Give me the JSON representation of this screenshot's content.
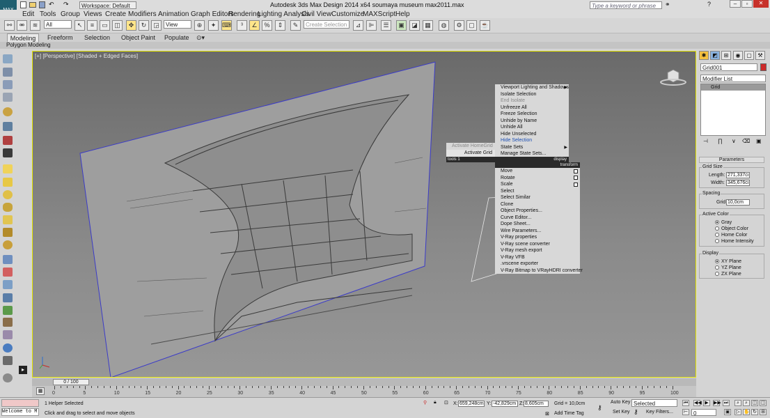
{
  "window": {
    "title": "Autodesk 3ds Max Design 2014 x64     soumaya museum max2011.max",
    "workspace": "Workspace: Default",
    "search_placeholder": "Type a keyword or phrase"
  },
  "menu": [
    "Edit",
    "Tools",
    "Group",
    "Views",
    "Create",
    "Modifiers",
    "Animation",
    "Graph Editors",
    "Rendering",
    "Lighting Analysis",
    "Civil View",
    "Customize",
    "MAXScript",
    "Help"
  ],
  "toolbar": {
    "selection_filter": "All",
    "ref_coord": "View",
    "named_selection_placeholder": "Create Selection Se"
  },
  "ribbon": {
    "tabs": [
      "Modeling",
      "Freeform",
      "Selection",
      "Object Paint",
      "Populate"
    ],
    "sub_label": "Polygon Modeling"
  },
  "viewport": {
    "label": "[+] [Perspective] [Shaded + Edged Faces]"
  },
  "quad_menu": {
    "display_items": [
      {
        "label": "Viewport Lighting and Shadows",
        "arrow": true,
        "state": "normal"
      },
      {
        "label": "Isolate Selection",
        "state": "normal"
      },
      {
        "label": "End Isolate",
        "state": "disabled"
      },
      {
        "label": "Unfreeze All",
        "state": "normal"
      },
      {
        "label": "Freeze Selection",
        "state": "normal"
      },
      {
        "label": "Unhide by Name",
        "state": "normal"
      },
      {
        "label": "Unhide All",
        "state": "normal"
      },
      {
        "label": "Hide Unselected",
        "state": "normal"
      },
      {
        "label": "Hide Selection",
        "state": "highlight"
      },
      {
        "label": "State Sets",
        "arrow": true,
        "state": "normal"
      },
      {
        "label": "Manage State Sets...",
        "state": "normal"
      }
    ],
    "tools_items": [
      {
        "label": "Activate HomeGrid",
        "state": "disabled"
      },
      {
        "label": "Activate Grid",
        "state": "normal"
      }
    ],
    "tools_header": "tools 1",
    "display_header": "display",
    "transform_header": "transform",
    "transform_items": [
      {
        "label": "Move",
        "box": true
      },
      {
        "label": "Rotate",
        "box": true
      },
      {
        "label": "Scale",
        "box": true
      },
      {
        "label": "Select"
      },
      {
        "label": "Select Similar"
      },
      {
        "label": "Clone"
      },
      {
        "label": "Object Properties..."
      },
      {
        "label": "Curve Editor..."
      },
      {
        "label": "Dope Sheet..."
      },
      {
        "label": "Wire Parameters..."
      },
      {
        "label": "V-Ray properties"
      },
      {
        "label": "V-Ray scene converter"
      },
      {
        "label": "V-Ray mesh export"
      },
      {
        "label": "V-Ray VFB"
      },
      {
        "label": ".vrscene exporter"
      },
      {
        "label": "V-Ray Bitmap to VRayHDRI converter"
      }
    ]
  },
  "command_panel": {
    "object_name": "Grid001",
    "object_color": "#cc2a2a",
    "modifier_list": "Modifier List",
    "stack_item": "Grid",
    "rollout": "Parameters",
    "grid_size": {
      "title": "Grid Size",
      "length_label": "Length:",
      "length": "271,337cı",
      "width_label": "Width:",
      "width": "345,676cı"
    },
    "spacing": {
      "title": "Spacing",
      "grid_label": "Grid:",
      "grid": "10,0cm"
    },
    "active_color": {
      "title": "Active Color",
      "options": [
        "Gray",
        "Object Color",
        "Home Color",
        "Home Intensity"
      ],
      "selected": "Gray"
    },
    "display": {
      "title": "Display",
      "options": [
        "XY Plane",
        "YZ Plane",
        "ZX Plane"
      ],
      "selected": "XY Plane"
    }
  },
  "timeline": {
    "slider": "0 / 100",
    "ticks": [
      "0",
      "5",
      "10",
      "15",
      "20",
      "25",
      "30",
      "35",
      "40",
      "45",
      "50",
      "55",
      "60",
      "65",
      "70",
      "75",
      "80",
      "85",
      "90",
      "95",
      "100"
    ]
  },
  "status": {
    "maxscript": "Welcome to M",
    "selected": "1 Helper Selected",
    "prompt": "Click and drag to select and move objects",
    "x_label": "X:",
    "x": "659,248cm",
    "y_label": "Y:",
    "y": "-42,829cm",
    "z_label": "Z:",
    "z": "8,605cm",
    "grid": "Grid = 10,0cm",
    "auto_key": "Auto Key",
    "set_key": "Set Key",
    "key_mode": "Selected",
    "key_filters": "Key Filters...",
    "add_time_tag": "Add Time Tag",
    "frame": "0"
  },
  "colors": {
    "viewport_border": "#e4e400",
    "accent": "#2a7ec8",
    "highlight_text": "#1c4fb4"
  }
}
